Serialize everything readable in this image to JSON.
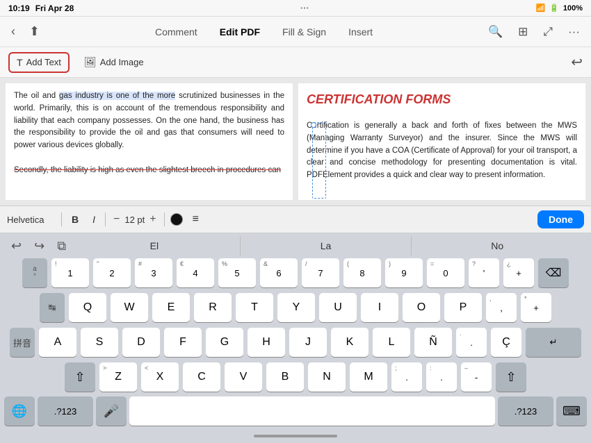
{
  "statusBar": {
    "time": "10:19",
    "date": "Fri Apr 28",
    "wifi": "WiFi",
    "battery": "100%"
  },
  "topToolbar": {
    "tabs": [
      "Comment",
      "Edit PDF",
      "Fill & Sign",
      "Insert"
    ],
    "activeTab": "Edit PDF"
  },
  "editToolbar": {
    "addTextLabel": "Add Text",
    "addImageLabel": "Add Image"
  },
  "formatToolbar": {
    "fontName": "Helvetica",
    "bold": "B",
    "italic": "I",
    "fontSize": "12 pt",
    "doneLabel": "Done"
  },
  "pdfLeft": {
    "text1": "The oil and gas industry is one of the more scrutinized businesses in the world. Primarily, this is on account of the tremendous responsibility and liability that each company possesses. On the one hand, the business has the responsibility to provide the oil and gas that consumers will need to power various devices globally.",
    "text2": "Secondly, the liability is high as even the slightest breech in procedures can"
  },
  "pdfRight": {
    "title": "CERTIFICATION FORMS",
    "body": "Certification is generally a back and forth of fixes between the MWS (Managing Warranty Surveyor) and the insurer. Since the MWS will determine if you have a COA (Certificate of Approval) for your oil transport, a clear and concise methodology for presenting documentation is vital. PDFElement provides a quick and clear way to present information."
  },
  "keyboard": {
    "suggestions": [
      "El",
      "La",
      "No"
    ],
    "row1": [
      "a°",
      "!1",
      "\"2",
      "#3",
      "€4",
      "%5",
      "&6",
      "/7",
      "(8",
      ")9",
      "=0",
      "?'",
      "¿+"
    ],
    "row2": [
      "Q",
      "W",
      "E",
      "R",
      "T",
      "Y",
      "U",
      "I",
      "O",
      "P",
      ",,",
      "*+"
    ],
    "row3": [
      "A",
      "S",
      "D",
      "F",
      "G",
      "H",
      "J",
      "K",
      "L",
      "Ñ",
      "..,,",
      "Ç"
    ],
    "row4": [
      "Z",
      "X",
      "C",
      "V",
      "B",
      "N",
      "M",
      ";.",
      ":.",
      "-_"
    ],
    "spaceLabel": "",
    "returnSymbol": "↵",
    "numLabel": ".?123",
    "micLabel": "🎤",
    "emojiLabel": "🌐",
    "hideLabel": "⌨"
  }
}
